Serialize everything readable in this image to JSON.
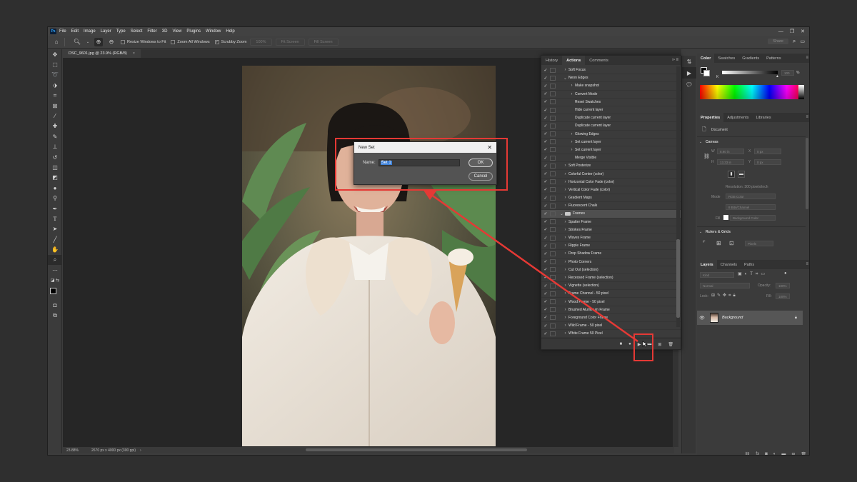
{
  "menubar": {
    "logo": "Ps",
    "items": [
      "File",
      "Edit",
      "Image",
      "Layer",
      "Type",
      "Select",
      "Filter",
      "3D",
      "View",
      "Plugins",
      "Window",
      "Help"
    ]
  },
  "options": {
    "resize_windows": "Resize Windows to Fit",
    "zoom_all": "Zoom All Windows",
    "scrubby_zoom": "Scrubby Zoom",
    "zoom_pct": "100%",
    "fit_screen": "Fit Screen",
    "fill_screen": "Fill Screen",
    "share": "Share"
  },
  "document": {
    "tab_title": "DSC_9601.jpg @ 23.9% (RGB/8)",
    "zoom": "23.88%",
    "dims": "2670 px x 4000 px (300 ppi)"
  },
  "actions_panel": {
    "tabs": [
      "History",
      "Actions",
      "Comments"
    ],
    "rows": [
      {
        "label": "Soft Focus",
        "chev": "›",
        "indent": 0,
        "folder": false
      },
      {
        "label": "Neon Edges",
        "chev": "⌄",
        "indent": 0,
        "folder": false
      },
      {
        "label": "Make snapshot",
        "chev": "›",
        "indent": 1,
        "folder": false
      },
      {
        "label": "Convert Mode",
        "chev": "›",
        "indent": 1,
        "folder": false
      },
      {
        "label": "Reset Swatches",
        "chev": "",
        "indent": 1,
        "folder": false
      },
      {
        "label": "Hide current layer",
        "chev": "",
        "indent": 1,
        "folder": false
      },
      {
        "label": "Duplicate current layer",
        "chev": "",
        "indent": 1,
        "folder": false
      },
      {
        "label": "Duplicate current layer",
        "chev": "",
        "indent": 1,
        "folder": false
      },
      {
        "label": "Glowing Edges",
        "chev": "›",
        "indent": 1,
        "folder": false
      },
      {
        "label": "Set current layer",
        "chev": "›",
        "indent": 1,
        "folder": false
      },
      {
        "label": "Set current layer",
        "chev": "›",
        "indent": 1,
        "folder": false
      },
      {
        "label": "Merge Visible",
        "chev": "",
        "indent": 1,
        "folder": false
      },
      {
        "label": "Soft Posterize",
        "chev": "›",
        "indent": 0,
        "folder": false
      },
      {
        "label": "Colorful Center (color)",
        "chev": "›",
        "indent": 0,
        "folder": false
      },
      {
        "label": "Horizontal Color Fade (color)",
        "chev": "›",
        "indent": 0,
        "folder": false
      },
      {
        "label": "Vertical Color Fade (color)",
        "chev": "›",
        "indent": 0,
        "folder": false
      },
      {
        "label": "Gradient Maps",
        "chev": "›",
        "indent": 0,
        "folder": false
      },
      {
        "label": "Fluorescent Chalk",
        "chev": "›",
        "indent": 0,
        "folder": false
      },
      {
        "label": "Frames",
        "chev": "⌄",
        "indent": -1,
        "folder": true,
        "selected": true
      },
      {
        "label": "Spatter Frame",
        "chev": "›",
        "indent": 0,
        "folder": false
      },
      {
        "label": "Strokes Frame",
        "chev": "›",
        "indent": 0,
        "folder": false
      },
      {
        "label": "Waves Frame",
        "chev": "›",
        "indent": 0,
        "folder": false
      },
      {
        "label": "Ripple Frame",
        "chev": "›",
        "indent": 0,
        "folder": false
      },
      {
        "label": "Drop Shadow Frame",
        "chev": "›",
        "indent": 0,
        "folder": false
      },
      {
        "label": "Photo Corners",
        "chev": "›",
        "indent": 0,
        "folder": false
      },
      {
        "label": "Cut Out (selection)",
        "chev": "›",
        "indent": 0,
        "folder": false
      },
      {
        "label": "Recessed Frame (selection)",
        "chev": "›",
        "indent": 0,
        "folder": false
      },
      {
        "label": "Vignette (selection)",
        "chev": "›",
        "indent": 0,
        "folder": false
      },
      {
        "label": "Frame Channel - 50 pixel",
        "chev": "›",
        "indent": 0,
        "folder": false
      },
      {
        "label": "Wood Frame - 50 pixel",
        "chev": "›",
        "indent": 0,
        "folder": false
      },
      {
        "label": "Brushed Aluminum Frame",
        "chev": "›",
        "indent": 0,
        "folder": false
      },
      {
        "label": "Foreground Color Frame",
        "chev": "›",
        "indent": 0,
        "folder": false
      },
      {
        "label": "Wild Frame - 50 pixel",
        "chev": "›",
        "indent": 0,
        "folder": false
      },
      {
        "label": "White Frame 50 Pixel",
        "chev": "›",
        "indent": 0,
        "folder": false
      }
    ]
  },
  "color_panel": {
    "tabs": [
      "Color",
      "Swatches",
      "Gradients",
      "Patterns"
    ],
    "k_label": "K",
    "k_value": "100",
    "k_pct": "%"
  },
  "properties_panel": {
    "tabs": [
      "Properties",
      "Adjustments",
      "Libraries"
    ],
    "document_label": "Document",
    "canvas_section": "Canvas",
    "w_label": "W",
    "w_value": "8.90 in",
    "h_label": "H",
    "h_value": "13.33 in",
    "x_label": "X",
    "x_value": "0 px",
    "y_label": "Y",
    "y_value": "0 px",
    "resolution": "Resolution: 300 pixels/inch",
    "mode_label": "Mode",
    "mode_value": "RGB Color",
    "bits_value": "8 Bits/Channel",
    "fill_label": "Fill",
    "fill_value": "Background Color",
    "rulers_section": "Rulers & Grids",
    "units_value": "Pixels"
  },
  "layers_panel": {
    "tabs": [
      "Layers",
      "Channels",
      "Paths"
    ],
    "kind_placeholder": "Kind",
    "blend_mode": "Normal",
    "opacity_label": "Opacity:",
    "opacity_value": "100%",
    "lock_label": "Lock:",
    "fill_label": "Fill:",
    "fill_value": "100%",
    "layer_name": "Background"
  },
  "dialog": {
    "title": "New Set",
    "name_label": "Name:",
    "name_value": "Set 1",
    "ok": "OK",
    "cancel": "Cancel"
  },
  "colors": {
    "highlight": "#e53935",
    "selection_blue": "#3f82d9"
  }
}
